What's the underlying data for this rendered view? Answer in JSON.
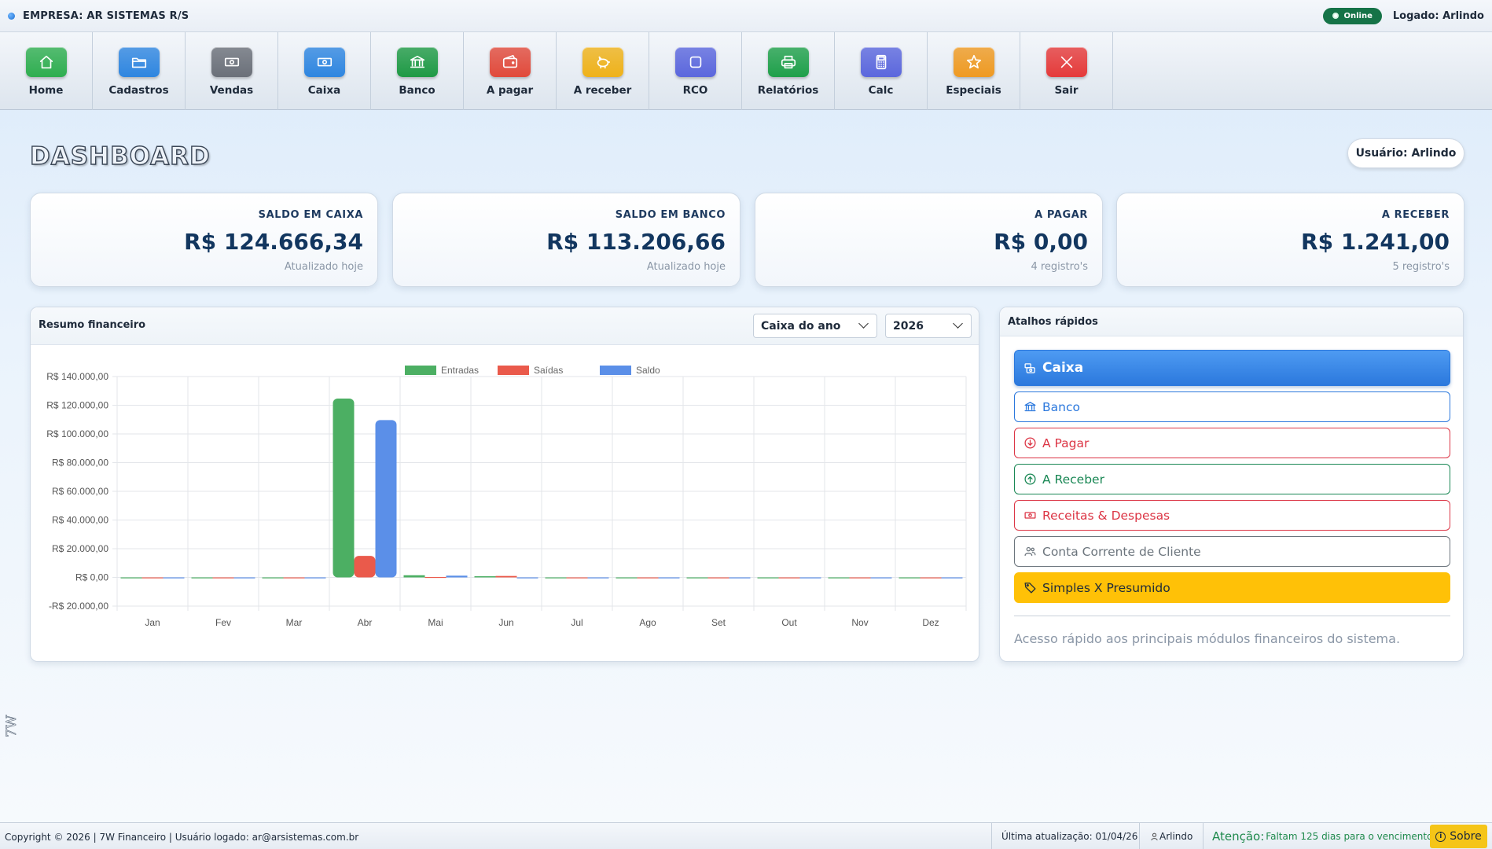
{
  "topbar": {
    "company": "EMPRESA: AR SISTEMAS R/S",
    "status": "Online",
    "logged": "Logado: Arlindo"
  },
  "toolbar": [
    {
      "label": "Home",
      "icon": "home-icon",
      "color": "#2fae50"
    },
    {
      "label": "Cadastros",
      "icon": "folder-icon",
      "color": "#2f86e0"
    },
    {
      "label": "Vendas",
      "icon": "cash-icon",
      "color": "#6b7079"
    },
    {
      "label": "Caixa",
      "icon": "cash-icon",
      "color": "#2f86e0"
    },
    {
      "label": "Banco",
      "icon": "bank-icon",
      "color": "#1f9a45"
    },
    {
      "label": "A pagar",
      "icon": "wallet-icon",
      "color": "#e14a3b"
    },
    {
      "label": "A receber",
      "icon": "piggy-bank-icon",
      "color": "#efb21a"
    },
    {
      "label": "RCO",
      "icon": "square-icon",
      "color": "#5b67dd"
    },
    {
      "label": "Relatórios",
      "icon": "printer-icon",
      "color": "#1fa04a"
    },
    {
      "label": "Calc",
      "icon": "calculator-icon",
      "color": "#5b67dd"
    },
    {
      "label": "Especiais",
      "icon": "star-icon",
      "color": "#ef9a22"
    },
    {
      "label": "Sair",
      "icon": "close-icon",
      "color": "#e53a3a"
    }
  ],
  "dashboard": {
    "title": "DASHBOARD",
    "user": "Usuário: Arlindo"
  },
  "cards": [
    {
      "label": "SALDO EM CAIXA",
      "value": "R$ 124.666,34",
      "sub": "Atualizado hoje"
    },
    {
      "label": "SALDO EM BANCO",
      "value": "R$ 113.206,66",
      "sub": "Atualizado hoje"
    },
    {
      "label": "A PAGAR",
      "value": "R$ 0,00",
      "sub": "4 registro's"
    },
    {
      "label": "A RECEBER",
      "value": "R$ 1.241,00",
      "sub": "5 registro's"
    }
  ],
  "chart_panel": {
    "title": "Resumo financeiro",
    "period_select": "Caixa do ano",
    "year_select": "2026"
  },
  "chart_data": {
    "type": "bar",
    "categories": [
      "Jan",
      "Fev",
      "Mar",
      "Abr",
      "Mai",
      "Jun",
      "Jul",
      "Ago",
      "Set",
      "Out",
      "Nov",
      "Dez"
    ],
    "series": [
      {
        "name": "Entradas",
        "color": "#4caf63",
        "values": [
          0,
          0,
          0,
          124666.34,
          1500,
          800,
          0,
          0,
          0,
          0,
          0,
          0
        ]
      },
      {
        "name": "Saídas",
        "color": "#ea5a4b",
        "values": [
          0,
          0,
          0,
          15000,
          300,
          1000,
          0,
          0,
          0,
          0,
          0,
          0
        ]
      },
      {
        "name": "Saldo",
        "color": "#5b8fe8",
        "values": [
          0,
          0,
          0,
          109666.34,
          1200,
          -200,
          0,
          0,
          0,
          0,
          0,
          0
        ]
      }
    ],
    "ylim": [
      -20000,
      140000
    ],
    "yticks": [
      140000,
      120000,
      100000,
      80000,
      60000,
      40000,
      20000,
      0,
      -20000
    ],
    "ytick_labels": [
      "R$ 140.000,00",
      "R$ 120.000,00",
      "R$ 100.000,00",
      "R$ 80.000,00",
      "R$ 60.000,00",
      "R$ 40.000,00",
      "R$ 20.000,00",
      "R$ 0,00",
      "-R$ 20.000,00"
    ],
    "legend": "top",
    "grid": true
  },
  "shortcuts": {
    "title": "Atalhos rápidos",
    "items": [
      {
        "label": "Caixa",
        "icon": "cash-register-icon",
        "color": "#2b78dd"
      },
      {
        "label": "Banco",
        "icon": "bank-icon",
        "color": "#2b78dd"
      },
      {
        "label": "A Pagar",
        "icon": "arrow-down-circle-icon",
        "color": "#dc3545"
      },
      {
        "label": "A Receber",
        "icon": "arrow-up-circle-icon",
        "color": "#198754"
      },
      {
        "label": "Receitas & Despesas",
        "icon": "cash-icon",
        "color": "#dc3545"
      },
      {
        "label": "Conta Corrente de Cliente",
        "icon": "people-icon",
        "color": "#6c757d"
      },
      {
        "label": "Simples X Presumido",
        "icon": "tag-icon",
        "color": "#ffc107"
      }
    ],
    "note": "Acesso rápido aos principais módulos financeiros do sistema."
  },
  "footer": {
    "copyright": "Copyright © 2026 | 7W Financeiro | Usuário logado: ar@arsistemas.com.br",
    "last_update": "Última atualização: 01/04/26",
    "user": "Arlindo",
    "attention_label": "Atenção:",
    "attention_text": "Faltam 125 dias para o vencimento.",
    "about": "Sobre"
  },
  "side_mark": "7W"
}
